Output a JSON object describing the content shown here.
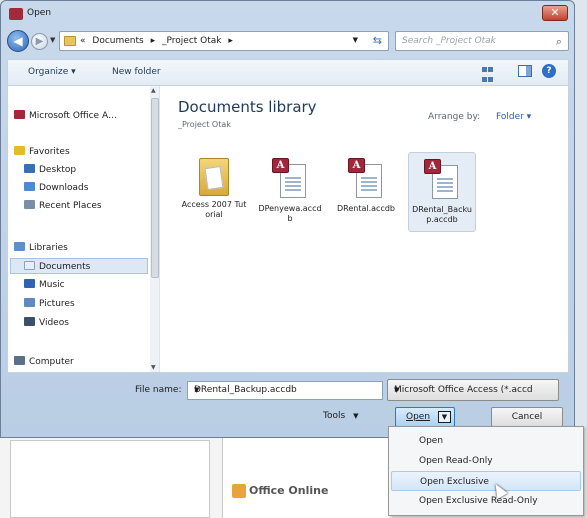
{
  "window": {
    "title": "Open",
    "close_label": "✕"
  },
  "address": {
    "crumbs": [
      "«",
      "Documents",
      "▸",
      "_Project Otak",
      "▸"
    ],
    "search_placeholder": "Search _Project Otak"
  },
  "toolbar": {
    "organize": "Organize ▾",
    "new_folder": "New folder",
    "help": "?"
  },
  "nav": {
    "items": [
      {
        "label": "Microsoft Office A…",
        "icon": "access-icon",
        "color": "#a3263a"
      },
      {
        "label": "Favorites",
        "icon": "star-icon",
        "color": "#e8b92c"
      },
      {
        "label": "Desktop",
        "icon": "desktop-icon",
        "color": "#3a6fb5"
      },
      {
        "label": "Downloads",
        "icon": "downloads-icon",
        "color": "#4a8ad4"
      },
      {
        "label": "Recent Places",
        "icon": "recent-places-icon",
        "color": "#7a8ea8"
      },
      {
        "label": "Libraries",
        "icon": "libraries-icon",
        "color": "#5d8fcf"
      },
      {
        "label": "Documents",
        "icon": "documents-icon",
        "color": "#e7eef7",
        "selected": true
      },
      {
        "label": "Music",
        "icon": "music-icon",
        "color": "#2f62b3"
      },
      {
        "label": "Pictures",
        "icon": "pictures-icon",
        "color": "#5e89c4"
      },
      {
        "label": "Videos",
        "icon": "videos-icon",
        "color": "#3d4f6a"
      },
      {
        "label": "Computer",
        "icon": "computer-icon",
        "color": "#5c6f88"
      }
    ]
  },
  "content": {
    "library_title": "Documents library",
    "library_subtitle": "_Project Otak",
    "arrange_label": "Arrange by:",
    "arrange_value": "Folder ▾",
    "files": [
      {
        "name": "Access 2007 Tutorial",
        "type": "folder"
      },
      {
        "name": "DPenyewa.accdb",
        "type": "access"
      },
      {
        "name": "DRental.accdb",
        "type": "access"
      },
      {
        "name": "DRental_Backup.accdb",
        "type": "access",
        "selected": true
      }
    ]
  },
  "bottom": {
    "filename_label": "File name:",
    "filename_value": "DRental_Backup.accdb",
    "filetype_value": "Microsoft Office Access (*.accd",
    "tools_label": "Tools",
    "open_label": "Open",
    "cancel_label": "Cancel"
  },
  "open_menu": {
    "items": [
      "Open",
      "Open Read-Only",
      "Open Exclusive",
      "Open Exclusive Read-Only"
    ],
    "hovered_index": 2
  },
  "background": {
    "logo_text": "Office Online"
  }
}
